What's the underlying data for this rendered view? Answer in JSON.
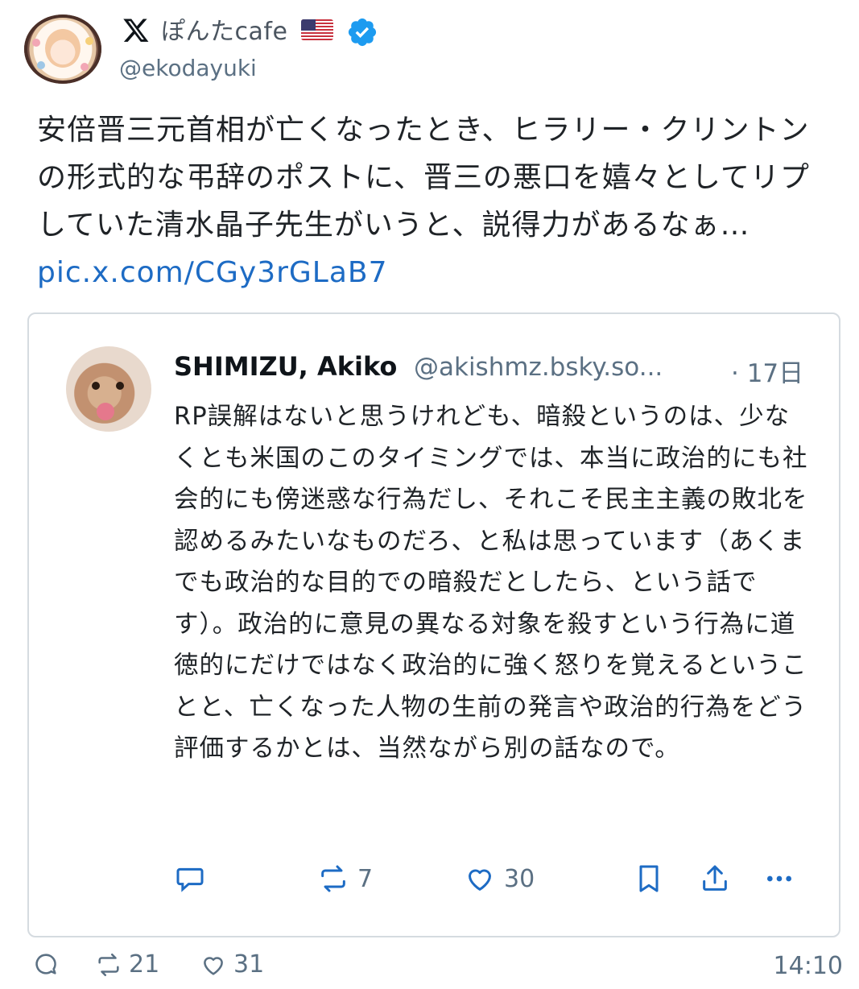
{
  "author": {
    "display_name": "ぽんたcafe",
    "handle": "@ekodayuki",
    "flag_icon": "us-flag-icon",
    "verified_icon": "verified-badge-icon",
    "platform_icon": "x-logo-icon"
  },
  "tweet": {
    "text": "安倍晋三元首相が亡くなったとき、ヒラリー・クリントンの形式的な弔辞のポストに、晋三の悪口を嬉々としてリプしていた清水晶子先生がいうと、説得力があるなぁ… ",
    "link": "pic.x.com/CGy3rGLaB7"
  },
  "quote": {
    "name": "SHIMIZU, Akiko",
    "handle": "@akishmz.bsky.so...",
    "time": "· 17日",
    "text": "RP誤解はないと思うけれども、暗殺というのは、少なくとも米国のこのタイミングでは、本当に政治的にも社会的にも傍迷惑な行為だし、それこそ民主主義の敗北を認めるみたいなものだろ、と私は思っています（あくまでも政治的な目的での暗殺だとしたら、という話です）。政治的に意見の異なる対象を殺すという行為に道徳的にだけではなく政治的に強く怒りを覚えるということと、亡くなった人物の生前の発言や政治的行為をどう評価するかとは、当然ながら別の話なので。",
    "actions": {
      "reply_count": "",
      "repost_count": "7",
      "like_count": "30"
    }
  },
  "footer": {
    "reply_count": "",
    "repost_count": "21",
    "like_count": "31",
    "time": "14:10"
  },
  "colors": {
    "link": "#1d6bc4",
    "verified": "#1d9bf0",
    "secondary_text": "#5b7083",
    "border": "#d5dbe0"
  }
}
